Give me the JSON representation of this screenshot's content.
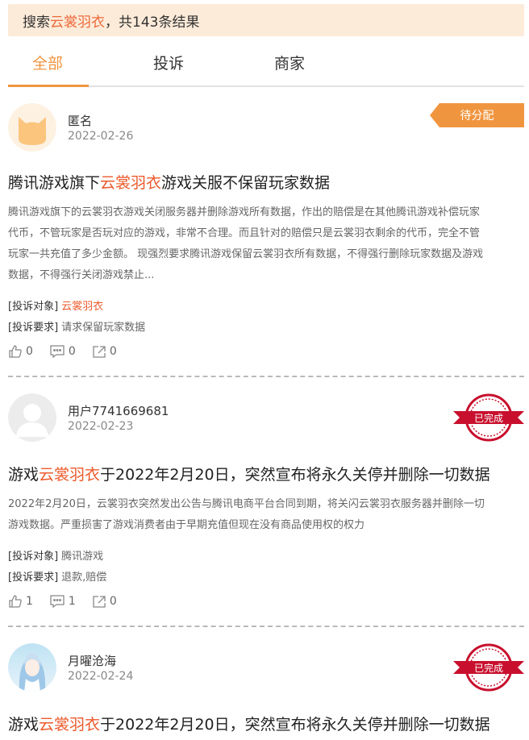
{
  "search": {
    "prefix": "搜索 ",
    "keyword": "云裳羽衣",
    "suffix": "，共143条结果"
  },
  "tabs": [
    {
      "label": "全部",
      "active": true
    },
    {
      "label": "投诉",
      "active": false
    },
    {
      "label": "商家",
      "active": false
    }
  ],
  "colors": {
    "accent": "#f0953f",
    "keyword": "#ec5a2c",
    "stamp": "#c8102e"
  },
  "complaints": [
    {
      "avatar": "cat-avatar-icon",
      "user": "匿名",
      "date": "2022-02-26",
      "status": "待分配",
      "title_pre": "腾讯游戏旗下",
      "title_kw": "云裳羽衣",
      "title_post": "游戏关服不保留玩家数据",
      "desc_lines": [
        "腾讯游戏旗下的云裳羽衣游戏关闭服务器并删除游戏所有数据，作出的赔偿是在其他腾讯游戏补偿玩家",
        "代币，不管玩家是否玩对应的游戏，非常不合理。而且针对的赔偿只是云裳羽衣剩余的代币，完全不管",
        "玩家一共充值了多少金额。 现强烈要求腾讯游戏保留云裳羽衣所有数据，不得强行删除玩家数据及游戏",
        "数据，不得强行关闭游戏禁止..."
      ],
      "target_label": "[投诉对象]",
      "target": "云裳羽衣",
      "request_label": "[投诉要求]",
      "request": "请求保留玩家数据",
      "likes": "0",
      "comments": "0",
      "shares": "0"
    },
    {
      "avatar": "default-user-avatar-icon",
      "user": "用户7741669681",
      "date": "2022-02-23",
      "status": "已完成",
      "title_pre": "游戏",
      "title_kw": "云裳羽衣",
      "title_post": "于2022年2月20日，突然宣布将永久关停并删除一切数据",
      "desc_lines": [
        "2022年2月20日，云裳羽衣突然发出公告与腾讯电商平台合同到期，将关闪云裳羽衣服务器并删除一切",
        "游戏数据。严重损害了游戏消费者由于早期充值但现在没有商品使用权的权力"
      ],
      "target_label": "[投诉对象]",
      "target": "腾讯游戏",
      "request_label": "[投诉要求]",
      "request": "退款,赔偿",
      "likes": "1",
      "comments": "1",
      "shares": "0"
    },
    {
      "avatar": "anime-girl-avatar-icon",
      "user": "月曜沧海",
      "date": "2022-02-24",
      "status": "已完成",
      "title_pre": "游戏",
      "title_kw": "云裳羽衣",
      "title_post": "于2022年2月20日，突然宣布将永久关停并删除一切数据"
    }
  ]
}
